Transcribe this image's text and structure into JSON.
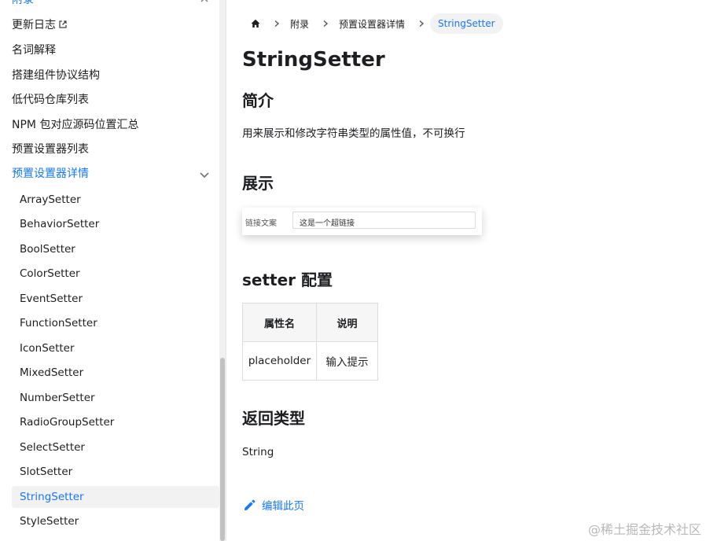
{
  "sidebar": {
    "category_top": "附录",
    "items": [
      {
        "label": "更新日志",
        "external": true
      },
      {
        "label": "名词解释"
      },
      {
        "label": "搭建组件协议结构"
      },
      {
        "label": "低代码仓库列表"
      },
      {
        "label": "NPM 包对应源码位置汇总"
      },
      {
        "label": "预置设置器列表"
      }
    ],
    "active_category": "预置设置器详情",
    "sub_items": [
      "ArraySetter",
      "BehaviorSetter",
      "BoolSetter",
      "ColorSetter",
      "EventSetter",
      "FunctionSetter",
      "IconSetter",
      "MixedSetter",
      "NumberSetter",
      "RadioGroupSetter",
      "SelectSetter",
      "SlotSetter",
      "StringSetter",
      "StyleSetter"
    ],
    "active_sub_item": "StringSetter"
  },
  "breadcrumb": {
    "items": [
      "附录",
      "预置设置器详情"
    ],
    "current": "StringSetter"
  },
  "page": {
    "title": "StringSetter",
    "sections": {
      "intro": {
        "heading": "简介",
        "text": "用来展示和修改字符串类型的属性值，不可换行"
      },
      "demo": {
        "heading": "展示",
        "label": "链接文案",
        "input_value": "这是一个超链接"
      },
      "config": {
        "heading": "setter 配置",
        "headers": [
          "属性名",
          "说明"
        ],
        "rows": [
          [
            "placeholder",
            "输入提示"
          ]
        ]
      },
      "return": {
        "heading": "返回类型",
        "text": "String"
      }
    },
    "edit_link": "编辑此页"
  },
  "watermark": "@稀土掘金技术社区",
  "colors": {
    "accent": "#1677ff",
    "active_bg": "#f2f2f2"
  },
  "icons": [
    "chevron-down-icon",
    "external-link-icon",
    "home-icon",
    "chevron-right-icon",
    "pencil-icon"
  ]
}
